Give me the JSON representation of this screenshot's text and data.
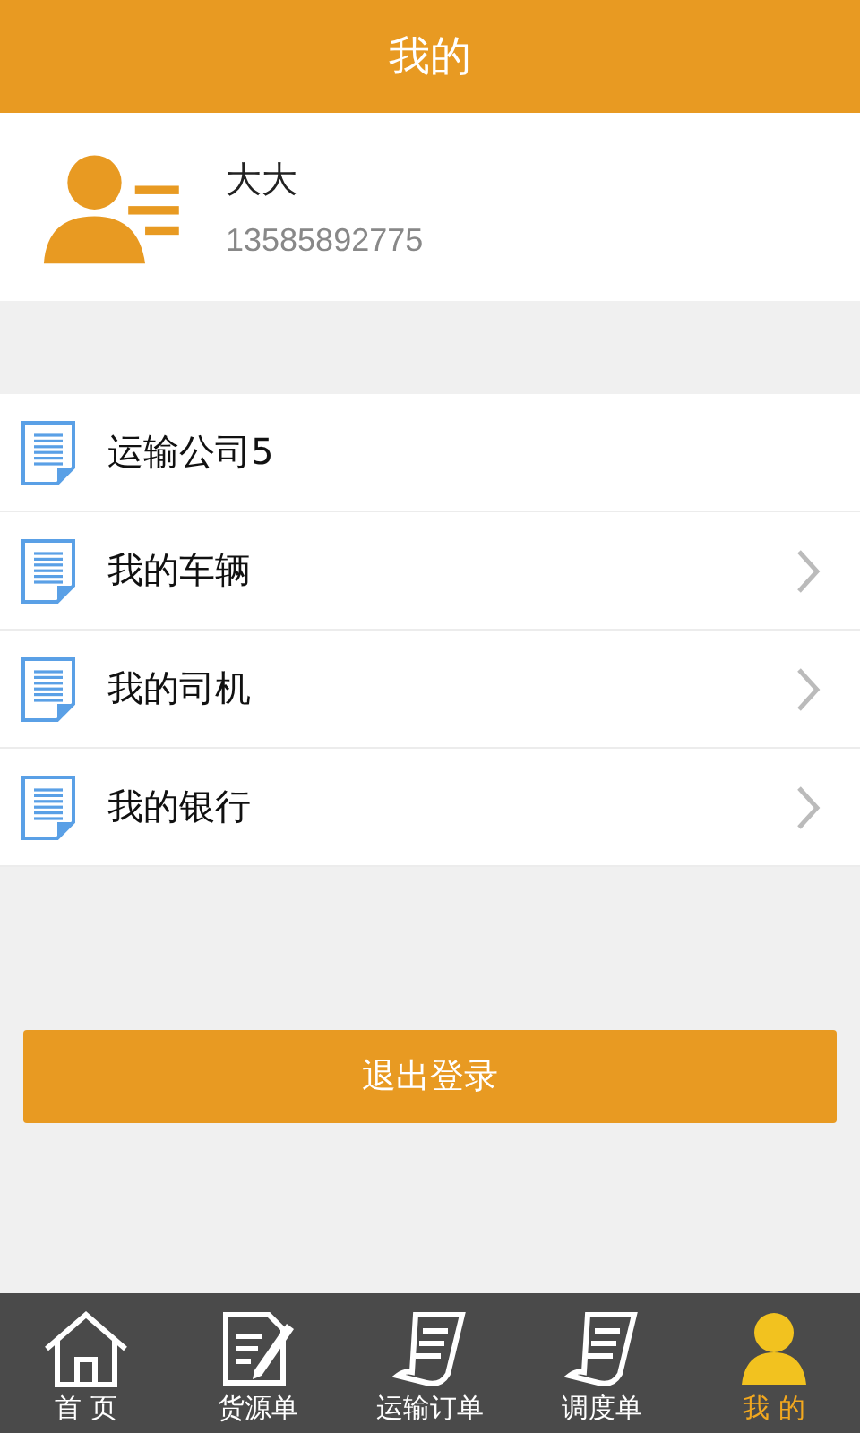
{
  "header": {
    "title": "我的"
  },
  "profile": {
    "name": "大大",
    "phone": "13585892775"
  },
  "menu": [
    {
      "label": "运输公司5",
      "chevron": false
    },
    {
      "label": "我的车辆",
      "chevron": true
    },
    {
      "label": "我的司机",
      "chevron": true
    },
    {
      "label": "我的银行",
      "chevron": true
    }
  ],
  "logout_button": "退出登录",
  "tabs": [
    {
      "label": "首 页",
      "kind": "home",
      "selected": false
    },
    {
      "label": "货源单",
      "kind": "edit",
      "selected": false
    },
    {
      "label": "运输订单",
      "kind": "receipt",
      "selected": false
    },
    {
      "label": "调度单",
      "kind": "receipt",
      "selected": false
    },
    {
      "label": "我 的",
      "kind": "person",
      "selected": true
    }
  ]
}
